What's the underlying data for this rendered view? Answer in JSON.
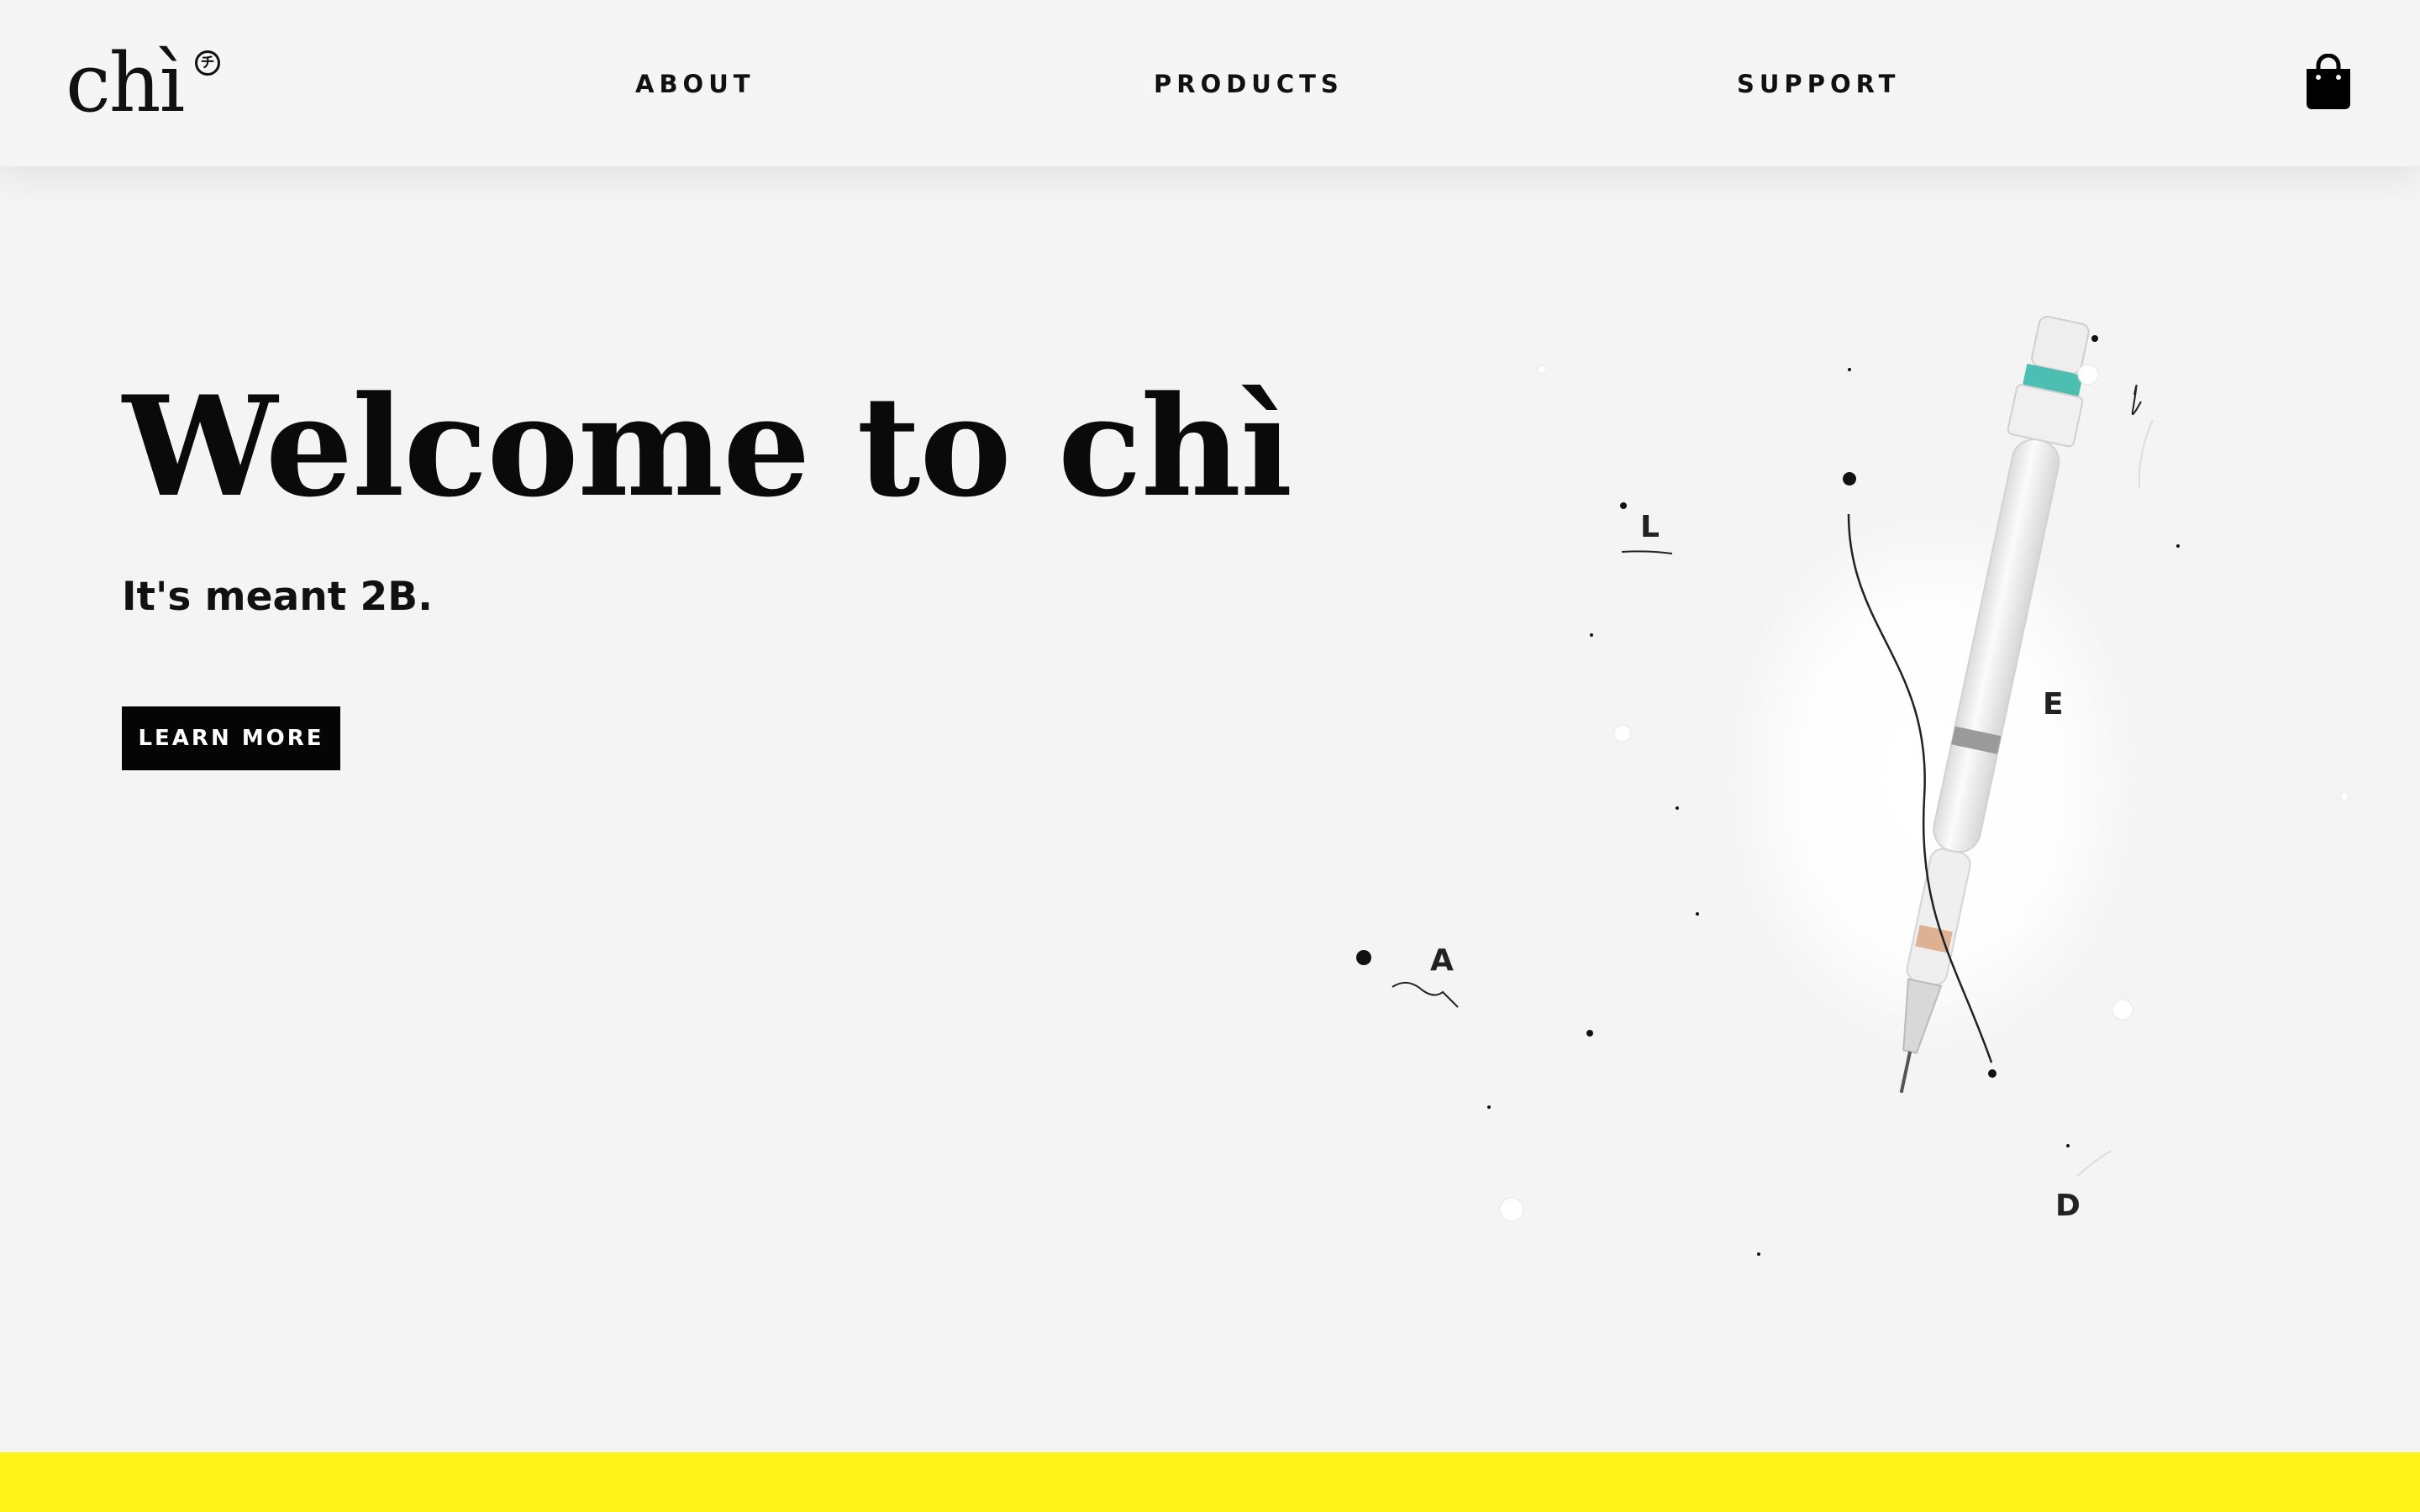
{
  "header": {
    "logo_text": "chì",
    "logo_badge": "チ",
    "nav": [
      {
        "label": "ABOUT"
      },
      {
        "label": "PRODUCTS"
      },
      {
        "label": "SUPPORT"
      }
    ],
    "cart_icon": "shopping-bag-icon"
  },
  "hero": {
    "title": "Welcome to chì",
    "subtitle": "It's meant 2B.",
    "cta_label": "LEARN MORE",
    "illustration_letters": [
      "L",
      "E",
      "A",
      "D"
    ]
  },
  "colors": {
    "background": "#f4f4f4",
    "text": "#0a0a0a",
    "button": "#050505",
    "footer_strip": "#fff317",
    "pencil_accent": "#2fb5a6"
  }
}
